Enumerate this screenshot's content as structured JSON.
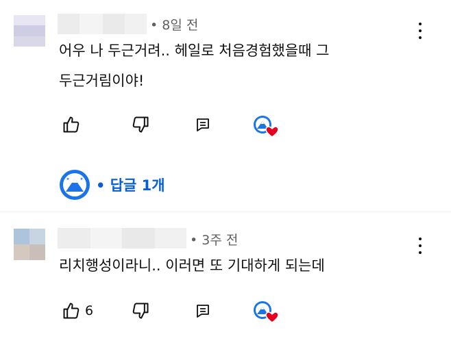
{
  "comments": [
    {
      "time": "• 8일 전",
      "text_line1": "어우 나 두근거려.. 헤일로 처음경험했을때 그",
      "text_line2": "두근거림이야!",
      "like_count": "",
      "replies": {
        "label": "• 답글 1개"
      }
    },
    {
      "time": "• 3주 전",
      "text_line1": "리치행성이라니.. 이러면 또 기대하게 되는데",
      "like_count": "6"
    }
  ],
  "colors": {
    "reply_link": "#065fd4",
    "creator_heart": "#e6001f",
    "creator_badge": "#1a73e8"
  }
}
